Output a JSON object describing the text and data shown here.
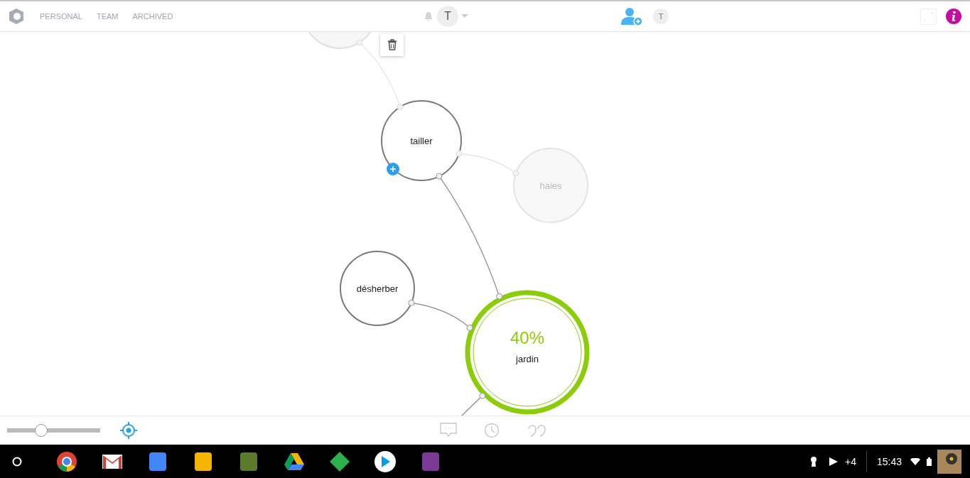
{
  "nav": {
    "tabs": [
      {
        "label": "PERSONAL",
        "selected": false
      },
      {
        "label": "TEAM",
        "selected": false
      },
      {
        "label": "ARCHIVED",
        "selected": false
      }
    ],
    "user_initial": "T",
    "member_initial": "T"
  },
  "map": {
    "nodes": [
      {
        "kind": "faded",
        "selected": false
      },
      {
        "label": "tailler",
        "kind": "normal",
        "selected": true
      },
      {
        "label": "haies",
        "kind": "faded",
        "selected": false
      },
      {
        "label": "désherber",
        "kind": "normal",
        "selected": false
      },
      {
        "label": "jardin",
        "kind": "goal",
        "selected": false,
        "progress": "40%"
      }
    ]
  },
  "zoom": {
    "level": 0.37
  },
  "taskbar": {
    "notification_count": "+4",
    "time": "15:43"
  }
}
